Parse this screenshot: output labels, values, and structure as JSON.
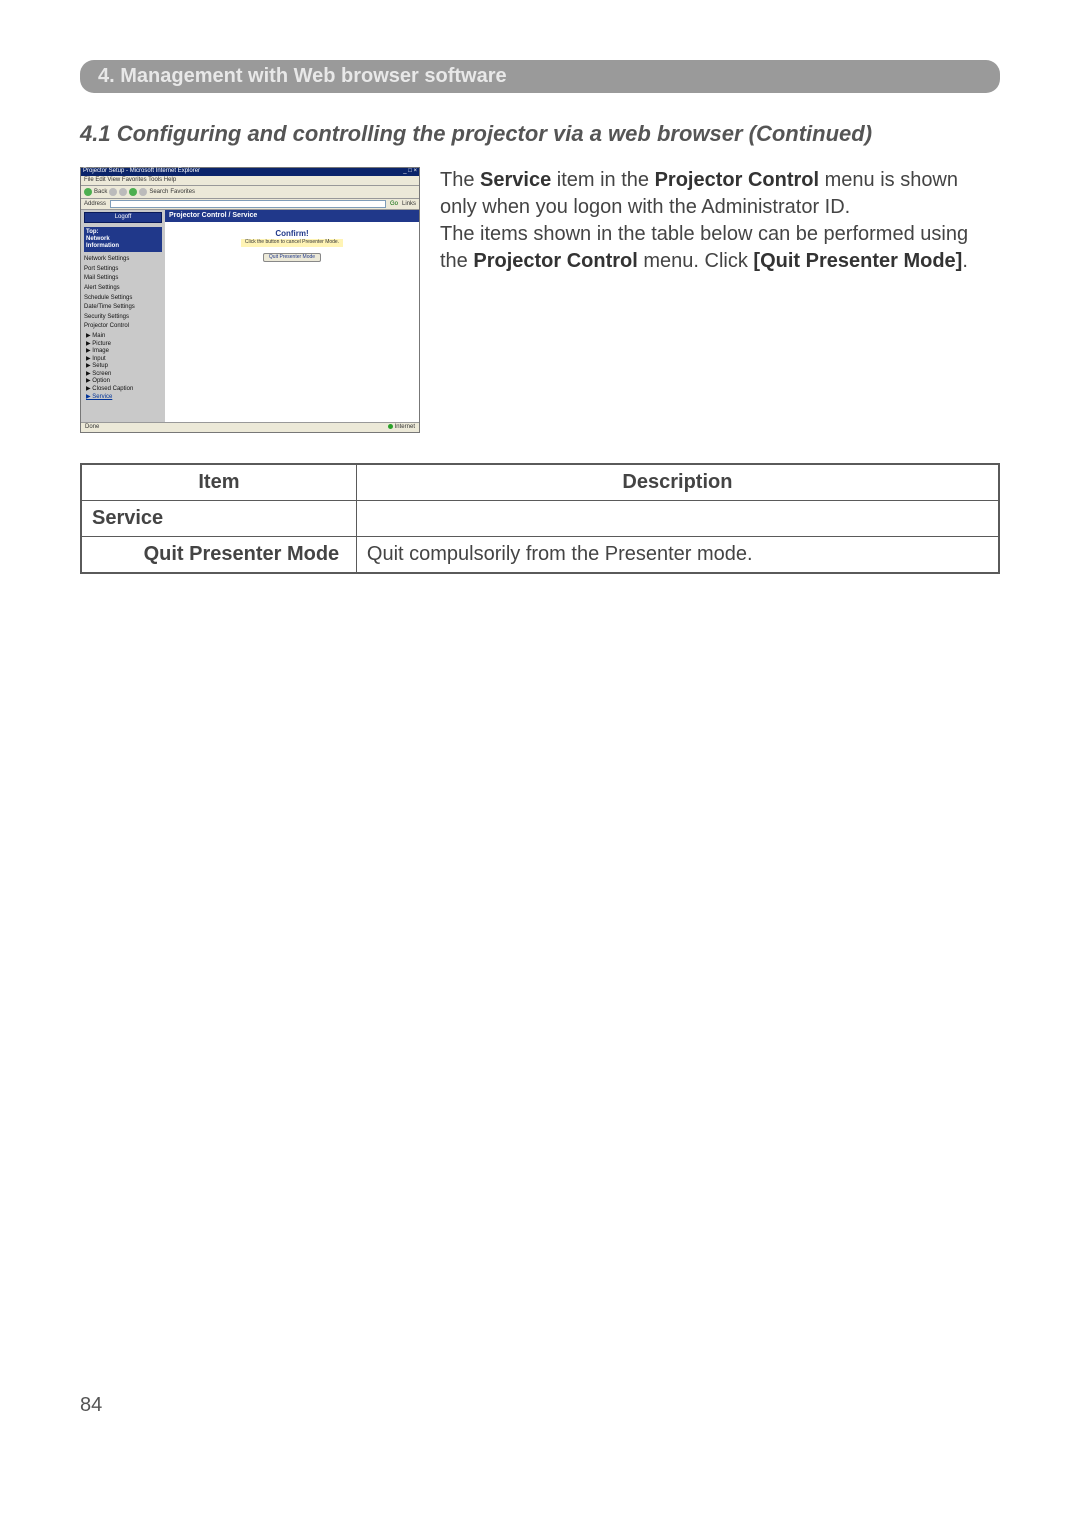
{
  "header_band": "4. Management with Web browser software",
  "section_heading": "4.1 Configuring and controlling the projector via a web browser (Continued)",
  "body": {
    "p1_a": "The ",
    "p1_b": "Service",
    "p1_c": " item in the ",
    "p1_d": "Projector Control",
    "p1_e": " menu is shown only when you logon with the Administrator ID.",
    "p2_a": "The items shown in the table below can be performed using the ",
    "p2_b": "Projector Control",
    "p2_c": " menu. Click ",
    "p2_d": "[Quit Presenter Mode]",
    "p2_e": "."
  },
  "table": {
    "col_item": "Item",
    "col_desc": "Description",
    "service": "Service",
    "qpm": "Quit Presenter Mode",
    "qpm_desc": "Quit compulsorily from the Presenter mode."
  },
  "screenshot": {
    "title": "Projector Setup - Microsoft Internet Explorer",
    "menubar": "File  Edit  View  Favorites  Tools  Help",
    "back": "Back",
    "search": "Search",
    "favorites": "Favorites",
    "address_label": "Address",
    "go": "Go",
    "links": "Links",
    "logoff": "Logoff",
    "top": "Top:",
    "network": "Network",
    "information": "Information",
    "nav": {
      "network_settings": "Network Settings",
      "port_settings": "Port Settings",
      "mail_settings": "Mail Settings",
      "alert_settings": "Alert Settings",
      "schedule_settings": "Schedule Settings",
      "datetime_settings": "Date/Time Settings",
      "security_settings": "Security Settings",
      "projector_control": "Projector Control",
      "sub": {
        "main": "▶ Main",
        "picture": "▶ Picture",
        "image": "▶ Image",
        "input": "▶ Input",
        "setup": "▶ Setup",
        "screen": "▶ Screen",
        "option": "▶ Option",
        "closed_caption": "▶ Closed Caption",
        "service": "▶ Service"
      }
    },
    "content_title": "Projector Control / Service",
    "confirm": "Confirm!",
    "confirm_hint": "Click the button to cancel Presenter Mode.",
    "quit_button": "Quit Presenter Mode",
    "done": "Done",
    "internet": "Internet"
  },
  "page_number": "84"
}
